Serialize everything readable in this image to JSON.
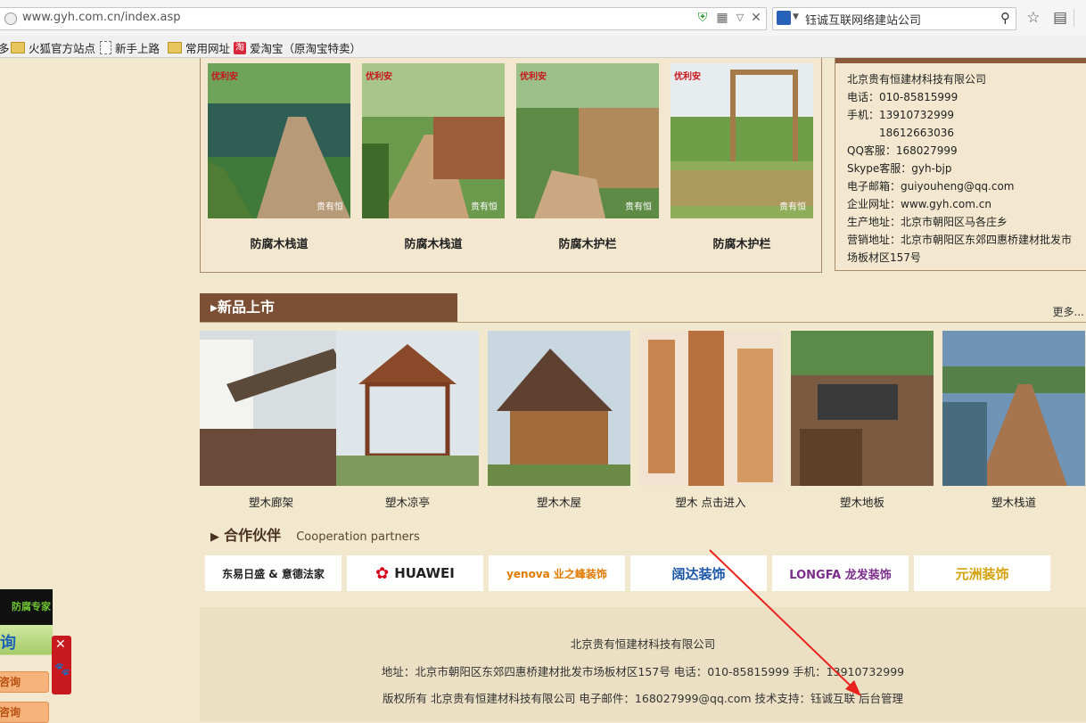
{
  "browser": {
    "url": "www.gyh.com.cn/index.asp",
    "search": "钰诚互联网络建站公司",
    "bookmarks": [
      "多",
      "火狐官方站点",
      "新手上路",
      "常用网址",
      "爱淘宝（原淘宝特卖）"
    ]
  },
  "products": [
    {
      "caption": "防腐木栈道",
      "brand": "优利安",
      "watermark": "贵有恒"
    },
    {
      "caption": "防腐木栈道",
      "brand": "优利安",
      "watermark": "贵有恒"
    },
    {
      "caption": "防腐木护栏",
      "brand": "优利安",
      "watermark": "贵有恒"
    },
    {
      "caption": "防腐木护栏",
      "brand": "优利安",
      "watermark": "贵有恒"
    }
  ],
  "contact": {
    "company": "北京贵有恒建材科技有限公司",
    "phone": "电话：010-85815999",
    "mobile1": "手机：13910732999",
    "mobile2": "18612663036",
    "qq": "QQ客服：168027999",
    "skype": "Skype客服：gyh-bjp",
    "email": "电子邮箱：guiyouheng@qq.com",
    "site": "企业网址：www.gyh.com.cn",
    "factory": "生产地址：北京市朝阳区马各庄乡",
    "sales1": "营销地址：北京市朝阳区东郊四惠桥建材批发市",
    "sales2": "场板材区157号"
  },
  "new_products": {
    "title": "新品上市",
    "more": "更多...",
    "items": [
      {
        "caption": "塑木廊架"
      },
      {
        "caption": "塑木凉亭"
      },
      {
        "caption": "塑木木屋"
      },
      {
        "caption": "塑木 点击进入"
      },
      {
        "caption": "塑木地板"
      },
      {
        "caption": "塑木栈道"
      }
    ]
  },
  "partners": {
    "title": "合作伙伴",
    "subtitle": "Cooperation partners",
    "logos": [
      {
        "name": "东易日盛 & 意德法家",
        "color": "#222222"
      },
      {
        "name": "HUAWEI",
        "color": "#d7001a"
      },
      {
        "name": "yenova 业之峰装饰",
        "color": "#e07a00"
      },
      {
        "name": "阔达装饰",
        "color": "#1c56a8"
      },
      {
        "name": "LONGFA 龙发装饰",
        "color": "#7b2c8b"
      },
      {
        "name": "元洲装饰",
        "color": "#d4a20b"
      }
    ]
  },
  "footer": {
    "company": "北京贵有恒建材科技有限公司",
    "address": "地址：北京市朝阳区东郊四惠桥建材批发市场板材区157号 电话：010-85815999      手机：13910732999",
    "copyright": "版权所有 北京贵有恒建材科技有限公司    电子邮件：168027999@qq.com 技术支持：钰诚互联 后台管理"
  },
  "side_widget": {
    "top_text": "防腐专家",
    "big": "询",
    "btn1": "咨询",
    "btn2": "咨询",
    "close": "✕"
  }
}
